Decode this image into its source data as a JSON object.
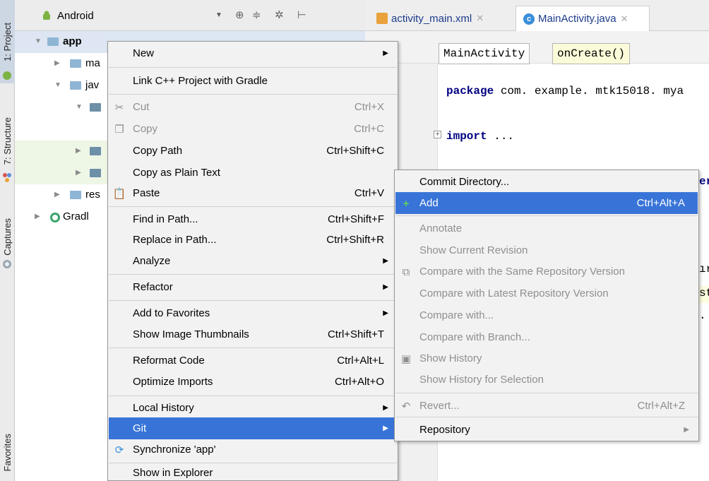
{
  "side_strip": {
    "project_tab": "1: Project",
    "structure_tab": "7: Structure",
    "captures_tab": "Captures",
    "favorites_tab": "Favorites"
  },
  "project_panel": {
    "view_selector": "Android",
    "tree": [
      {
        "label": "app"
      },
      {
        "label": "ma"
      },
      {
        "label": "jav"
      },
      {
        "label": ""
      },
      {
        "label": ""
      },
      {
        "label": ""
      },
      {
        "label": "res"
      },
      {
        "label": "Gradl"
      }
    ]
  },
  "editor": {
    "tabs": [
      {
        "label": "activity_main.xml"
      },
      {
        "label": "MainActivity.java"
      }
    ],
    "breadcrumbs": [
      "MainActivity",
      "onCreate()"
    ],
    "lines": {
      "package_kw": "package",
      "package_name": " com. example. mtk15018. mya",
      "import_kw": "import",
      "import_rest": " ...",
      "frag1": "er",
      "frag2": "ır",
      "frag3": "st",
      "frag4": ". c"
    }
  },
  "context_menu": {
    "items": [
      {
        "label": "New",
        "shortcut": "",
        "submenu": true
      },
      {
        "label": "Link C++ Project with Gradle",
        "shortcut": ""
      },
      {
        "label": "Cut",
        "shortcut": "Ctrl+X",
        "icon": "scissors-icon"
      },
      {
        "label": "Copy",
        "shortcut": "Ctrl+C",
        "icon": "copy-icon"
      },
      {
        "label": "Copy Path",
        "shortcut": "Ctrl+Shift+C"
      },
      {
        "label": "Copy as Plain Text",
        "shortcut": ""
      },
      {
        "label": "Paste",
        "shortcut": "Ctrl+V",
        "icon": "paste-icon"
      },
      {
        "label": "Find in Path...",
        "shortcut": "Ctrl+Shift+F"
      },
      {
        "label": "Replace in Path...",
        "shortcut": "Ctrl+Shift+R"
      },
      {
        "label": "Analyze",
        "shortcut": "",
        "submenu": true
      },
      {
        "label": "Refactor",
        "shortcut": "",
        "submenu": true
      },
      {
        "label": "Add to Favorites",
        "shortcut": "",
        "submenu": true
      },
      {
        "label": "Show Image Thumbnails",
        "shortcut": "Ctrl+Shift+T"
      },
      {
        "label": "Reformat Code",
        "shortcut": "Ctrl+Alt+L"
      },
      {
        "label": "Optimize Imports",
        "shortcut": "Ctrl+Alt+O"
      },
      {
        "label": "Local History",
        "shortcut": "",
        "submenu": true
      },
      {
        "label": "Git",
        "shortcut": "",
        "submenu": true
      },
      {
        "label": "Synchronize 'app'",
        "shortcut": "",
        "icon": "sync-icon"
      },
      {
        "label": "Show in Explorer",
        "shortcut": ""
      }
    ]
  },
  "git_submenu": {
    "items": [
      {
        "label": "Commit Directory...",
        "shortcut": ""
      },
      {
        "label": "Add",
        "shortcut": "Ctrl+Alt+A",
        "icon": "plus-icon"
      },
      {
        "label": "Annotate",
        "shortcut": ""
      },
      {
        "label": "Show Current Revision",
        "shortcut": ""
      },
      {
        "label": "Compare with the Same Repository Version",
        "shortcut": "",
        "icon": "compare-icon"
      },
      {
        "label": "Compare with Latest Repository Version",
        "shortcut": ""
      },
      {
        "label": "Compare with...",
        "shortcut": ""
      },
      {
        "label": "Compare with Branch...",
        "shortcut": ""
      },
      {
        "label": "Show History",
        "shortcut": "",
        "icon": "history-icon"
      },
      {
        "label": "Show History for Selection",
        "shortcut": ""
      },
      {
        "label": "Revert...",
        "shortcut": "Ctrl+Alt+Z",
        "icon": "revert-icon"
      },
      {
        "label": "Repository",
        "shortcut": "",
        "submenu": true
      }
    ]
  }
}
